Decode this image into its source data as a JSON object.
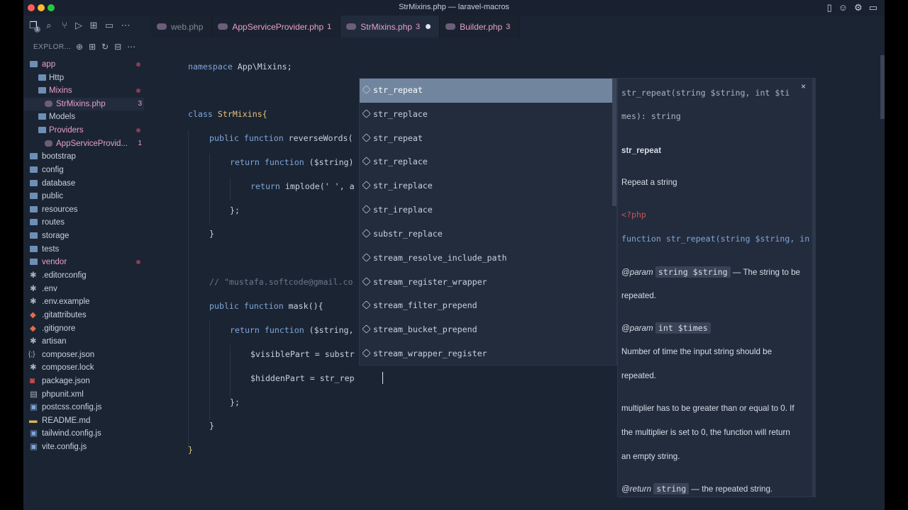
{
  "window": {
    "title": "StrMixins.php — laravel-macros"
  },
  "colors": {
    "red": "#ff5f57",
    "yellow": "#febc2e",
    "green": "#28c840"
  },
  "activity_bar": {
    "badge": "1"
  },
  "tabs": [
    {
      "label": "web.php",
      "badge": ""
    },
    {
      "label": "AppServiceProvider.php",
      "badge": "1"
    },
    {
      "label": "StrMixins.php",
      "badge": "3"
    },
    {
      "label": "Builder.php",
      "badge": "3"
    }
  ],
  "sidebar": {
    "header": "EXPLOR...",
    "items": [
      {
        "label": "app",
        "badge": ""
      },
      {
        "label": "Http",
        "badge": ""
      },
      {
        "label": "Mixins",
        "badge": ""
      },
      {
        "label": "StrMixins.php",
        "badge": "3"
      },
      {
        "label": "Models",
        "badge": ""
      },
      {
        "label": "Providers",
        "badge": ""
      },
      {
        "label": "AppServiceProvid...",
        "badge": "1"
      },
      {
        "label": "bootstrap",
        "badge": ""
      },
      {
        "label": "config",
        "badge": ""
      },
      {
        "label": "database",
        "badge": ""
      },
      {
        "label": "public",
        "badge": ""
      },
      {
        "label": "resources",
        "badge": ""
      },
      {
        "label": "routes",
        "badge": ""
      },
      {
        "label": "storage",
        "badge": ""
      },
      {
        "label": "tests",
        "badge": ""
      },
      {
        "label": "vendor",
        "badge": ""
      },
      {
        "label": ".editorconfig",
        "badge": ""
      },
      {
        "label": ".env",
        "badge": ""
      },
      {
        "label": ".env.example",
        "badge": ""
      },
      {
        "label": ".gitattributes",
        "badge": ""
      },
      {
        "label": ".gitignore",
        "badge": ""
      },
      {
        "label": "artisan",
        "badge": ""
      },
      {
        "label": "composer.json",
        "badge": ""
      },
      {
        "label": "composer.lock",
        "badge": ""
      },
      {
        "label": "package.json",
        "badge": ""
      },
      {
        "label": "phpunit.xml",
        "badge": ""
      },
      {
        "label": "postcss.config.js",
        "badge": ""
      },
      {
        "label": "README.md",
        "badge": ""
      },
      {
        "label": "tailwind.config.js",
        "badge": ""
      },
      {
        "label": "vite.config.js",
        "badge": ""
      }
    ]
  },
  "code": {
    "l1_kw": "namespace",
    "l1_rest": " App\\Mixins;",
    "l2_kw": "class",
    "l2_rest": " StrMixins{",
    "l3_kw": "public function",
    "l3_rest": " reverseWords(",
    "l4_kw": "return function",
    "l4_rest": " ($string)",
    "l5_kw": "return",
    "l5_rest": " implode(' ', a",
    "l6": "};",
    "l7": "}",
    "l8": "// \"mustafa.softcode@gmail.co",
    "l9_kw": "public function",
    "l9_rest": " mask(){",
    "l10_kw": "return function",
    "l10_rest": " ($string,",
    "l11": "$visiblePart = substr",
    "l12": "$hiddenPart = str_rep",
    "l13": "};",
    "l14": "}",
    "l15": "}"
  },
  "suggestions": [
    "str_repeat",
    "str_replace",
    "str_repeat",
    "str_replace",
    "str_ireplace",
    "str_ireplace",
    "substr_replace",
    "stream_resolve_include_path",
    "stream_register_wrapper",
    "stream_filter_prepend",
    "stream_bucket_prepend",
    "stream_wrapper_register"
  ],
  "doc": {
    "signature_1": "str_repeat(string $string, int $ti",
    "signature_2": "mes): string",
    "name": "str_repeat",
    "description": "Repeat a string",
    "php_tag": "<?php",
    "code": "function str_repeat(string $string, in",
    "param1_tag": "@param",
    "param1_code": "string $string",
    "param1_desc": "— The string to be",
    "param1_desc2": "repeated.",
    "param2_tag": "@param",
    "param2_code": "int $times",
    "param2_desc": "Number of time the input string should be",
    "param2_desc2": "repeated.",
    "note1": "multiplier has to be greater than or equal to 0. If",
    "note2": "the multiplier is set to 0, the function will return",
    "note3": "an empty string.",
    "return_tag": "@return",
    "return_code": "string",
    "return_desc": "— the repeated string."
  }
}
